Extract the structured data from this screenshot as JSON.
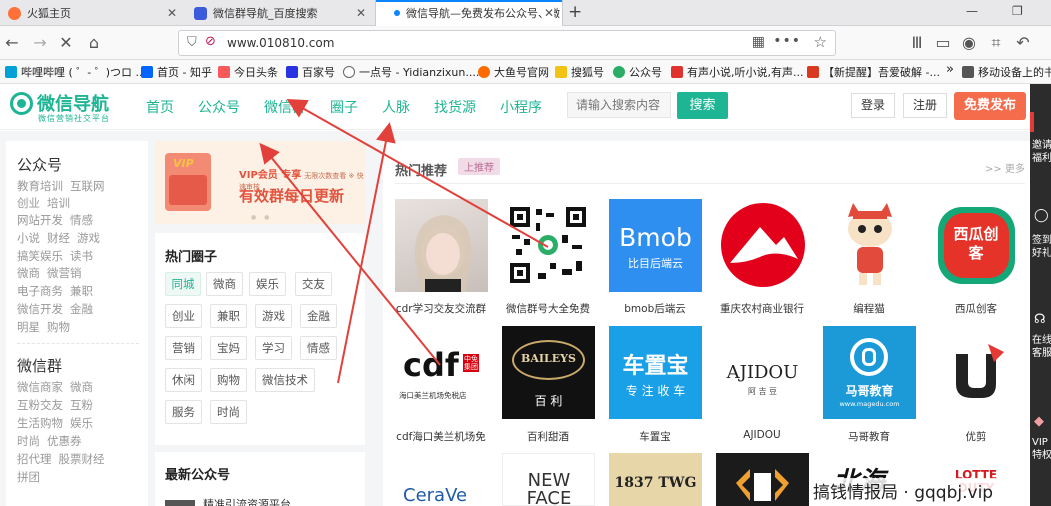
{
  "browser": {
    "tabs": [
      {
        "label": "火狐主页",
        "icon": "firefox-icon",
        "active": false
      },
      {
        "label": "微信群导航_百度搜索",
        "icon": "baidu-icon",
        "active": false
      },
      {
        "label": "微信导航—免费发布公众号、微",
        "icon": "site-icon",
        "active": true
      }
    ],
    "url": "www.010810.com",
    "bookmarks": [
      {
        "label": "哔哩哔哩 ( ゜- ゜)つロ ...",
        "color": "#00a1d6"
      },
      {
        "label": "首页 - 知乎",
        "color": "#0066ff"
      },
      {
        "label": "今日头条",
        "color": "#f85959"
      },
      {
        "label": "百家号",
        "color": "#2932e1"
      },
      {
        "label": "一点号 - Yidianzixun....",
        "color": "#666666"
      },
      {
        "label": "大鱼号官网",
        "color": "#ff6a00"
      },
      {
        "label": "搜狐号",
        "color": "#f3c314"
      },
      {
        "label": "公众号",
        "color": "#2aae67"
      },
      {
        "label": "有声小说,听小说,有声...",
        "color": "#e0332f"
      },
      {
        "label": "【新提醒】吾爱破解 -...",
        "color": "#d9391f"
      },
      {
        "label": "移动设备上的书",
        "color": "#555555"
      }
    ]
  },
  "site": {
    "logo": {
      "name": "微信导航",
      "slogan": "微信营销社交平台"
    },
    "nav": [
      "首页",
      "公众号",
      "微信群",
      "圈子",
      "人脉",
      "找货源",
      "小程序"
    ],
    "search": {
      "placeholder": "请输入搜索内容",
      "button": "搜索"
    },
    "login": "登录",
    "register": "注册",
    "publish": "免费发布"
  },
  "categories": {
    "gzh_title": "公众号",
    "gzh_rows": [
      [
        "教育培训",
        "互联网"
      ],
      [
        "创业",
        "培训"
      ],
      [
        "网站开发",
        "情感"
      ],
      [
        "小说",
        "财经",
        "游戏"
      ],
      [
        "搞笑娱乐",
        "读书"
      ],
      [
        "微商",
        "微营销"
      ],
      [
        "电子商务",
        "兼职"
      ],
      [
        "微信开发",
        "金融"
      ],
      [
        "明星",
        "购物"
      ]
    ],
    "wxq_title": "微信群",
    "wxq_rows": [
      [
        "微信商家",
        "微商"
      ],
      [
        "互粉交友",
        "互粉"
      ],
      [
        "生活购物",
        "娱乐"
      ],
      [
        "时尚",
        "优惠券"
      ],
      [
        "招代理",
        "股票财经"
      ],
      [
        "拼团"
      ]
    ]
  },
  "vip_banner": {
    "line1": "VIP会员 专享",
    "line1_small": "无限次数查看 ※ 快速审核",
    "line2": "有效群每日更新"
  },
  "hot_circles": {
    "title": "热门圈子",
    "tags": [
      "同城",
      "微商",
      "娱乐",
      "交友",
      "创业",
      "兼职",
      "游戏",
      "金融",
      "营销",
      "宝妈",
      "学习",
      "情感",
      "休闲",
      "购物",
      "微信技术",
      "服务",
      "时尚"
    ]
  },
  "latest": {
    "title": "最新公众号",
    "first_item": "精准引流资源平台"
  },
  "hot_rec": {
    "title": "热门推荐",
    "badge": "上推荐",
    "more": ">> 更多",
    "row1": [
      "cdr学习交友交流群",
      "微信群号大全免费",
      "bmob后端云",
      "重庆农村商业银行",
      "编程猫",
      "西瓜创客"
    ],
    "row2": [
      "cdf海口美兰机场免",
      "百利甜酒",
      "车置宝",
      "AJIDOU",
      "马哥教育",
      "优剪"
    ],
    "logos": {
      "bmob_main": "Bmob",
      "bmob_sub": "比目后端云",
      "xigua": "西瓜创客",
      "cdf_main": "cdf",
      "cdf_cn": "中免集团",
      "cdf_sub": "海口美兰机场免税店",
      "baileys": "BAILEYS",
      "baileys_cn": "百 利",
      "chezhibao": "车置宝",
      "chezhibao_sub": "专 注 收 车",
      "ajidou": "AJIDOU",
      "ajidou_cn": "阿 吉 豆",
      "mage": "马哥教育",
      "mage_url": "www.magedu.com",
      "cerave": "CeraVe",
      "newface": "NEW FACE",
      "twg": "1837 TWG",
      "beihai": "北海",
      "lotte": "LOTTE DUTY"
    }
  },
  "watermark": "搞钱情报局 · gqqbj.vip",
  "right_sidebar": [
    "邀请",
    "福利",
    "签到",
    "好礼",
    "在线",
    "客服",
    "VIP",
    "特权"
  ],
  "colors": {
    "accent": "#1db594",
    "publish": "#f56c4d",
    "arrow": "#e2413b"
  }
}
